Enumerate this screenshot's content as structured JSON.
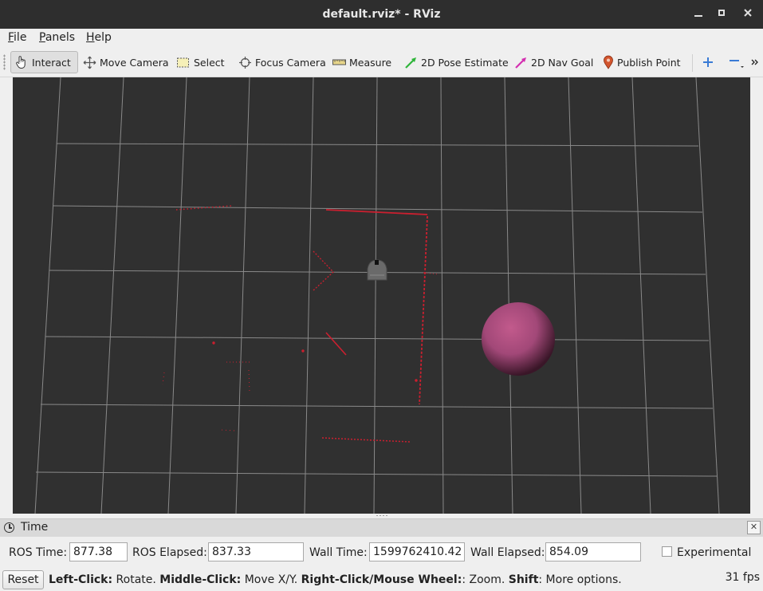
{
  "window": {
    "title": "default.rviz* - RViz",
    "controls": [
      "minimize-icon",
      "maximize-icon",
      "close-icon"
    ]
  },
  "menu": [
    "File",
    "Panels",
    "Help"
  ],
  "toolbar": {
    "tools": [
      {
        "label": "Interact",
        "icon": "hand-pointer-icon",
        "active": true
      },
      {
        "label": "Move Camera",
        "icon": "move-camera-icon"
      },
      {
        "label": "Select",
        "icon": "select-rectangle-icon"
      },
      {
        "label": "Focus Camera",
        "icon": "focus-camera-icon"
      },
      {
        "label": "Measure",
        "icon": "ruler-icon"
      },
      {
        "label": "2D Pose Estimate",
        "icon": "green-arrow-icon"
      },
      {
        "label": "2D Nav Goal",
        "icon": "magenta-arrow-icon"
      },
      {
        "label": "Publish Point",
        "icon": "map-pin-icon"
      }
    ],
    "extra_icons": [
      "plus-icon",
      "minus-icon",
      "more-chevron-icon"
    ]
  },
  "viewport": {
    "background": "#303030",
    "grid_color": "#a0a0a0",
    "laser_color": "#cc1f2f",
    "sphere_color": "#b0507a",
    "robot_color": "#6a6a6a"
  },
  "time_panel": {
    "title": "Time",
    "ros_time_label": "ROS Time:",
    "ros_time": "877.38",
    "ros_elapsed_label": "ROS Elapsed:",
    "ros_elapsed": "837.33",
    "wall_time_label": "Wall Time:",
    "wall_time": "1599762410.42",
    "wall_elapsed_label": "Wall Elapsed:",
    "wall_elapsed": "854.09",
    "experimental_label": "Experimental"
  },
  "status": {
    "reset_label": "Reset",
    "hint": {
      "left_click": "Left-Click:",
      "left_action": " Rotate. ",
      "middle_click": "Middle-Click:",
      "middle_action": " Move X/Y. ",
      "right_click": "Right-Click/Mouse Wheel:",
      "right_action": ": Zoom. ",
      "shift": "Shift",
      "shift_action": ": More options."
    },
    "fps": "31 fps"
  }
}
